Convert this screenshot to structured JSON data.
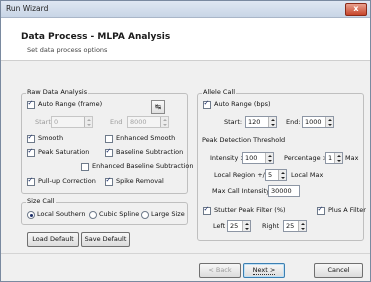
{
  "window": {
    "title": "Run Wizard",
    "close_symbol": "x"
  },
  "header": {
    "title": "Data Process - MLPA Analysis",
    "subtitle": "Set data process options"
  },
  "raw": {
    "group_label": "Raw Data Analysis",
    "auto_range_label": "Auto Range (frame)",
    "start_label": "Start",
    "start_value": "0",
    "end_label": "End",
    "end_value": "8000",
    "smooth_label": "Smooth",
    "enhanced_smooth_label": "Enhanced Smooth",
    "peak_saturation_label": "Peak Saturation",
    "baseline_subtraction_label": "Baseline Subtraction",
    "enhanced_baseline_label": "Enhanced Baseline Subtraction",
    "pullup_label": "Pull-up Correction",
    "spike_label": "Spike Removal"
  },
  "size_call": {
    "group_label": "Size Call",
    "local_southern_label": "Local Southern",
    "cubic_spline_label": "Cubic Spline",
    "large_size_label": "Large Size"
  },
  "left_buttons": {
    "load_default": "Load Default",
    "save_default": "Save Default"
  },
  "allele": {
    "group_label": "Allele Call",
    "auto_range_label": "Auto Range (bps)",
    "start_label": "Start:",
    "start_value": "120",
    "end_label": "End:",
    "end_value": "1000"
  },
  "peak": {
    "label": "Peak Detection Threshold",
    "intensity_label": "Intensity >",
    "intensity_value": "100",
    "percentage_label": "Percentage >",
    "percentage_value": "1",
    "max_label": "Max",
    "local_region_label": "Local Region +/-",
    "local_region_value": "5",
    "local_max_label": "Local Max",
    "max_call_label": "Max Call Intensity:",
    "max_call_value": "30000"
  },
  "stutter": {
    "label": "Stutter Peak Filter (%)",
    "plus_a_label": "Plus A Filter",
    "left_label": "Left",
    "left_value": "25",
    "right_label": "Right",
    "right_value": "25"
  },
  "footer": {
    "back": "< Back",
    "next": "Next >",
    "cancel": "Cancel"
  }
}
